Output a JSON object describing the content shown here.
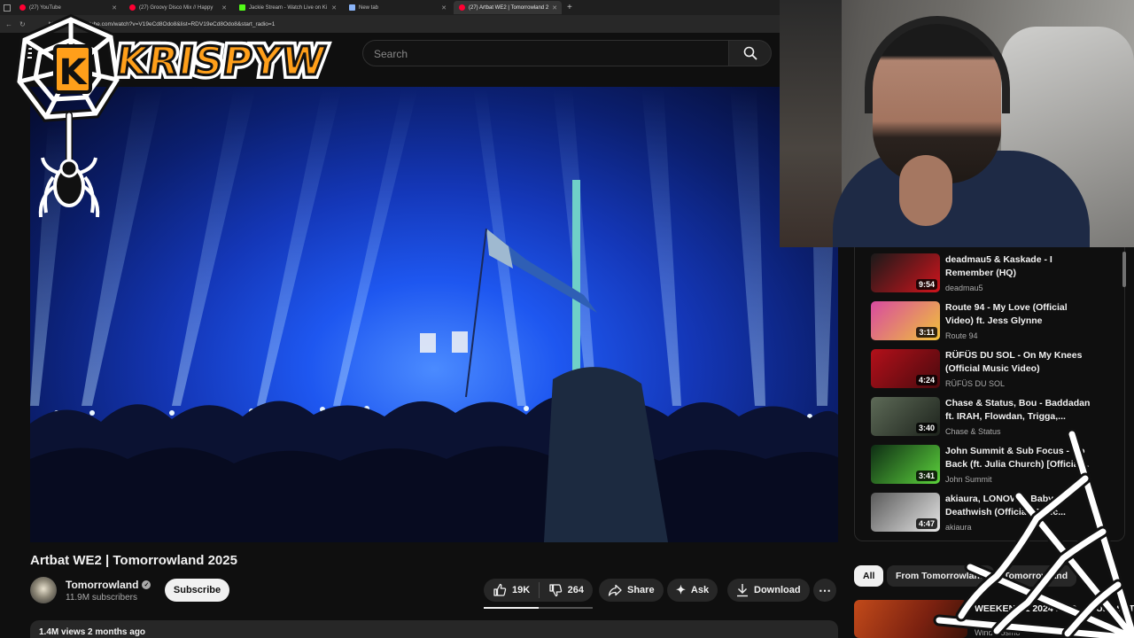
{
  "browser": {
    "tabs": [
      {
        "title": "(27) YouTube",
        "icon": "youtube-icon"
      },
      {
        "title": "(27) Groovy Disco Mix // Happy",
        "icon": "youtube-icon"
      },
      {
        "title": "Jackie Stream - Watch Live on Ki",
        "icon": "kick-icon"
      },
      {
        "title": "New tab",
        "icon": "page-icon"
      },
      {
        "title": "(27) Artbat WE2 | Tomorrowland 2",
        "icon": "youtube-icon"
      }
    ],
    "url": "https://www.youtube.com/watch?v=V19eCd8Odo8&list=RDV19eCd8Odo8&start_radio=1"
  },
  "masthead": {
    "search_placeholder": "Search"
  },
  "video": {
    "title": "Artbat WE2 | Tomorrowland 2025",
    "channel": "Tomorrowland",
    "subscribers": "11.9M subscribers",
    "subscribe_label": "Subscribe",
    "likes": "19K",
    "dislikes": "264",
    "like_ratio": 0.5,
    "share_label": "Share",
    "ask_label": "Ask",
    "download_label": "Download",
    "meta": "1.4M views  2 months ago"
  },
  "recommendations": [
    {
      "title": "deadmau5 & Kaskade - I Remember (HQ)",
      "channel": "deadmau5",
      "duration": "9:54",
      "thumb_colors": [
        "#1a1a1a",
        "#d0141c"
      ]
    },
    {
      "title": "Route 94 - My Love (Official Video) ft. Jess Glynne",
      "channel": "Route 94",
      "duration": "3:11",
      "thumb_colors": [
        "#d84aa0",
        "#f0c23a"
      ]
    },
    {
      "title": "RÜFÜS DU SOL - On My Knees (Official Music Video)",
      "channel": "RÜFÜS DU SOL",
      "duration": "4:24",
      "thumb_colors": [
        "#b3101a",
        "#4a0a0e"
      ]
    },
    {
      "title": "Chase & Status, Bou - Baddadan ft. IRAH, Flowdan, Trigga,...",
      "channel": "Chase & Status",
      "duration": "3:40",
      "thumb_colors": [
        "#5d6a57",
        "#1d231c"
      ]
    },
    {
      "title": "John Summit & Sub Focus - Go Back (ft. Julia Church) [Official...",
      "channel": "John Summit",
      "duration": "3:41",
      "thumb_colors": [
        "#0e2d14",
        "#5cd23c"
      ]
    },
    {
      "title": "akiaura, LONOWN, Baby - Deathwish (Official Music...",
      "channel": "akiaura",
      "duration": "4:47",
      "thumb_colors": [
        "#5a5a5a",
        "#e6e6e6"
      ]
    }
  ],
  "chips": [
    {
      "label": "All",
      "active": true
    },
    {
      "label": "From Tomorrowland",
      "active": false
    },
    {
      "label": "Tomorrowland",
      "active": false
    }
  ],
  "bottom_rec": {
    "title": "WEEKEND 1 2024 MAD... (FULL SET)",
    "channel": "Wind Cosmo"
  },
  "overlay": {
    "logo_text": "KRISPYW",
    "logo_letter": "K",
    "accent_color": "#ff9f1a"
  }
}
